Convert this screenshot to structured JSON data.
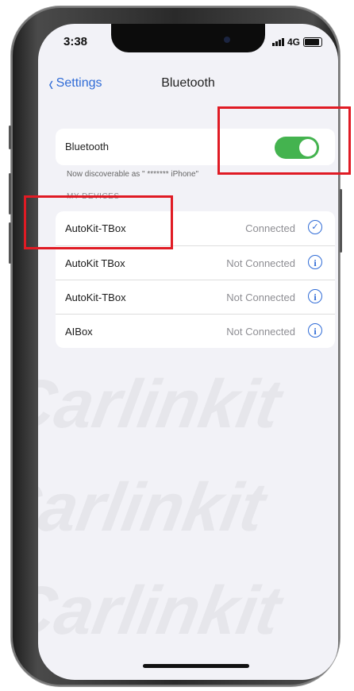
{
  "status_bar": {
    "time": "3:38",
    "network": "4G"
  },
  "nav": {
    "back_label": "Settings",
    "title": "Bluetooth"
  },
  "bluetooth": {
    "label": "Bluetooth",
    "enabled": true,
    "discoverable_text": "Now discoverable as \" ******* iPhone\""
  },
  "section_header": "MY DEVICES",
  "devices": [
    {
      "name": "AutoKit-TBox",
      "status": "Connected",
      "icon": "checkmark-circle-icon"
    },
    {
      "name": "AutoKit TBox",
      "status": "Not Connected",
      "icon": "info-icon"
    },
    {
      "name": "AutoKit-TBox",
      "status": "Not Connected",
      "icon": "info-icon"
    },
    {
      "name": "AIBox",
      "status": "Not Connected",
      "icon": "info-icon"
    }
  ],
  "watermark": "Carlinkit",
  "colors": {
    "accent": "#2f6bd6",
    "toggle_on": "#44b34f",
    "highlight": "#e01b24"
  }
}
